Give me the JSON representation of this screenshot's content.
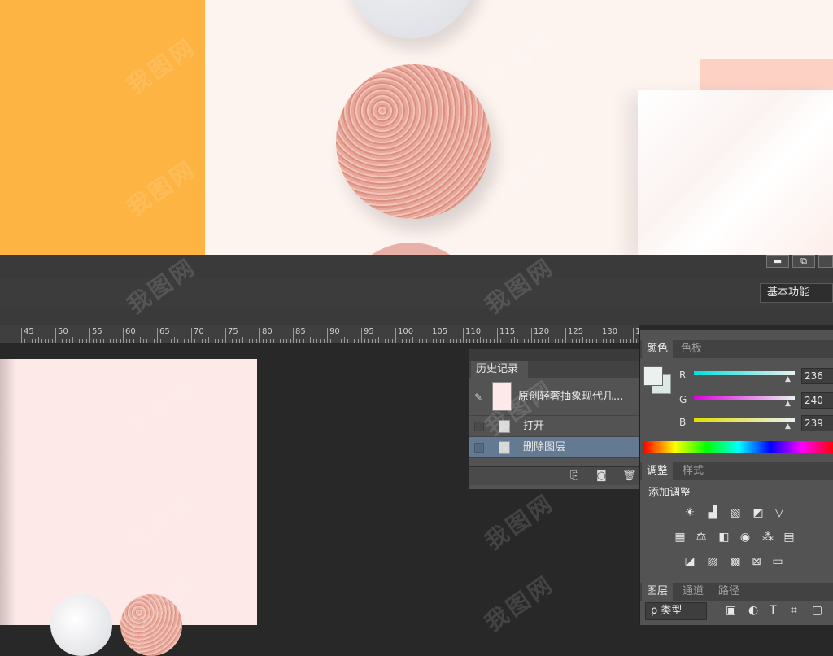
{
  "window_controls": {
    "minimize": "▬",
    "restore": "⧉"
  },
  "workspace": {
    "label": "基本功能"
  },
  "ruler": {
    "ticks": [
      "45",
      "50",
      "55",
      "60",
      "65",
      "70",
      "75",
      "80",
      "85",
      "90",
      "95",
      "100",
      "105",
      "110",
      "115",
      "120",
      "125",
      "130",
      "1"
    ]
  },
  "history": {
    "tab": "历史记录",
    "snapshot_label": "原创轻奢抽象现代几...",
    "items": [
      {
        "label": "打开",
        "selected": false
      },
      {
        "label": "删除图层",
        "selected": true
      }
    ]
  },
  "color_panel": {
    "tabs": [
      "颜色",
      "色板"
    ],
    "channels": [
      {
        "name": "R",
        "value": "236"
      },
      {
        "name": "G",
        "value": "240"
      },
      {
        "name": "B",
        "value": "239"
      }
    ],
    "foreground_color": "#ecf0ef"
  },
  "adjust_panel": {
    "tabs": [
      "调整",
      "样式"
    ],
    "title": "添加调整",
    "icons_row1": [
      "brightness-icon",
      "levels-icon",
      "curves-icon",
      "exposure-icon",
      "vibrance-icon"
    ],
    "icons_row2": [
      "hue-saturation-icon",
      "color-balance-icon",
      "black-white-icon",
      "photo-filter-icon",
      "channel-mixer-icon",
      "color-lookup-icon"
    ],
    "icons_row3": [
      "invert-icon",
      "posterize-icon",
      "threshold-icon",
      "selective-color-icon",
      "gradient-map-icon"
    ]
  },
  "layers_panel": {
    "tabs": [
      "图层",
      "通道",
      "路径"
    ],
    "filter_label": "ρ 类型"
  },
  "watermark": "我图网"
}
